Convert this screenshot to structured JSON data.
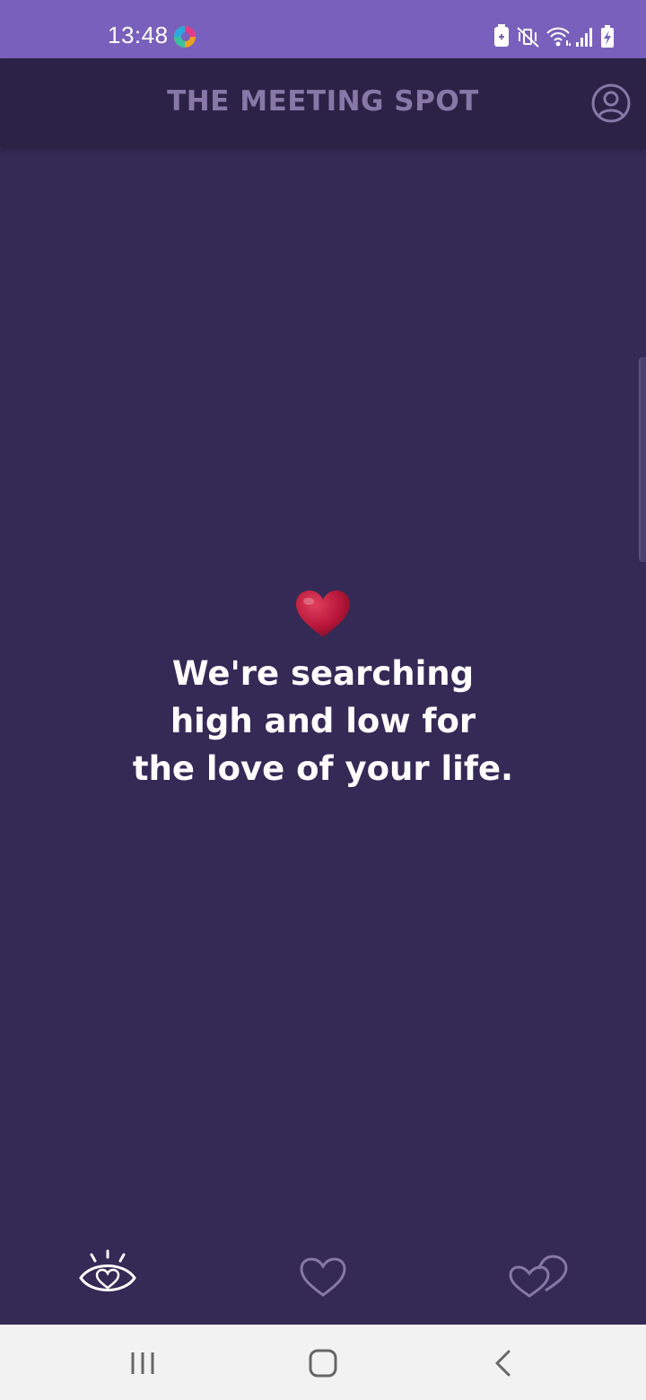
{
  "status_bar": {
    "time": "13:48",
    "icons": [
      "browser-badge-icon",
      "battery-saver-icon",
      "mute-vibrate-icon",
      "wifi-icon",
      "signal-icon",
      "battery-charging-icon"
    ]
  },
  "header": {
    "title": "THE MEETING SPOT",
    "profile_icon": "user-circle-icon"
  },
  "main": {
    "emoji": "heart",
    "message_lines": [
      "We're searching",
      "high and low for",
      "the love of your life."
    ]
  },
  "bottom_nav": {
    "tabs": [
      {
        "name": "discover",
        "icon": "eye-heart-icon",
        "active": true
      },
      {
        "name": "likes",
        "icon": "heart-outline-icon",
        "active": false
      },
      {
        "name": "matches",
        "icon": "double-heart-icon",
        "active": false
      }
    ]
  },
  "system_nav": [
    "recents-icon",
    "home-icon",
    "back-icon"
  ],
  "colors": {
    "status_bar": "#7a60bd",
    "header": "#2b2246",
    "background": "#352a56",
    "title": "#8778a8",
    "heart": "#b8163a",
    "inactive_icon": "#8778a8",
    "active_icon": "#ffffff"
  }
}
